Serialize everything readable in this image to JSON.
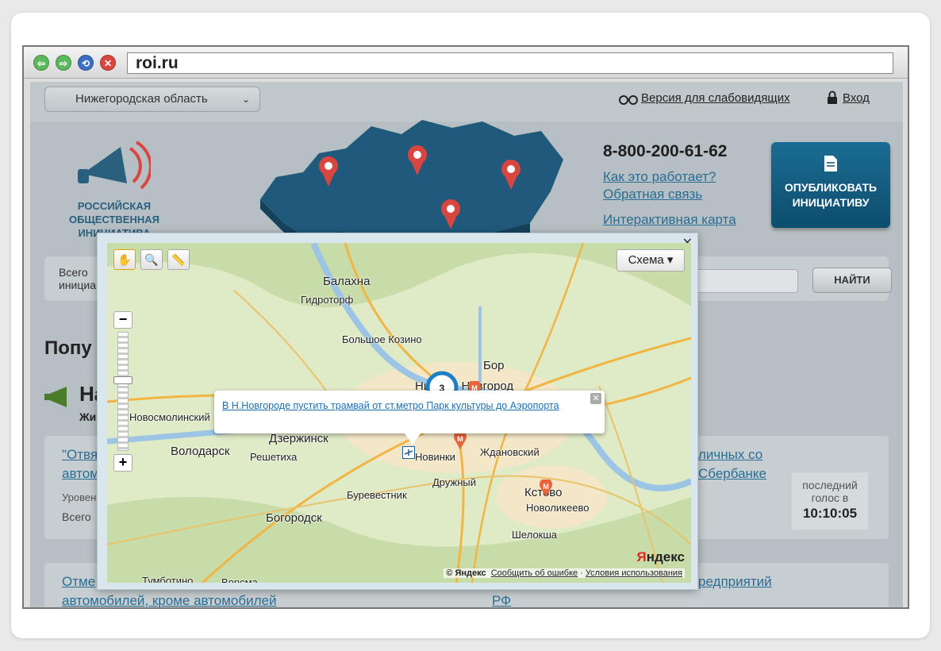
{
  "browser": {
    "url": "roi.ru"
  },
  "site": {
    "region_select": "Нижегородская область",
    "accessibility_link": "Версия для слабовидящих",
    "login_link": "Вход",
    "logo_lines": [
      "РОССИЙСКАЯ",
      "ОБЩЕСТВЕННАЯ",
      "ИНИЦИАТИВА"
    ],
    "phone": "8-800-200-61-62",
    "links": [
      "Как это работает?",
      "Обратная связь",
      "Интерактивная карта"
    ],
    "publish_button": "ОПУБЛИКОВАТЬ ИНИЦИАТИВУ",
    "search": {
      "label_line1": "Всего",
      "label_line2": "инициа",
      "button": "НАЙТИ"
    },
    "popular_heading": "Попу",
    "section_letters": "На",
    "section_sub": "Жи",
    "bg_items": [
      "\"Отвя",
      "автом",
      "Уровен",
      "Всего",
      "личных со",
      "Сбербанке",
      "Отме",
      "автомобилей, кроме автомобилей",
      "редприятий",
      "РФ"
    ],
    "last_vote": {
      "label": "последний голос в",
      "time": "10:10:05"
    }
  },
  "map": {
    "scheme_button": "Схема ▾",
    "balloon_link": "В Н.Новгороде пустить трамвай от ст.метро Парк культуры до Аэропорта",
    "cluster_count": "3",
    "labels": [
      "Балахна",
      "Гидроторф",
      "Большое Козино",
      "Бор",
      "Нижний Новгород",
      "Новосмолинский",
      "Дзержинск",
      "Володарск",
      "Решетиха",
      "Новинки",
      "Ждановский",
      "Дружный",
      "Буревестник",
      "Кстово",
      "Новоликеево",
      "Богородск",
      "Шелокша",
      "Тумботино",
      "Ворсма"
    ],
    "copyright": "© Яндекс",
    "report_error": "Сообщить об ошибке",
    "terms": "Условия использования",
    "brand": "Яндекс"
  }
}
